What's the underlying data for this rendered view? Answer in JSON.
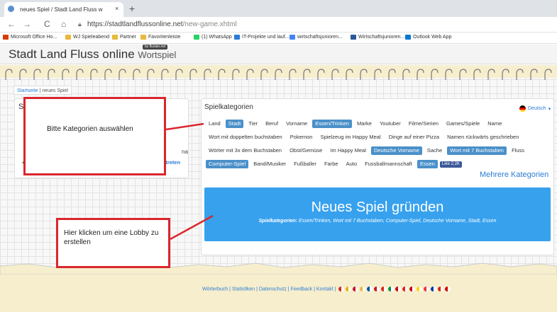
{
  "browser": {
    "tab_title": "neues Spiel / Stadt Land Fluss w",
    "tab_close": "×",
    "new_tab": "+",
    "url_host": "https://stadtlandflussonline.net",
    "url_path": "/new-game.xhtml",
    "nav": {
      "back": "←",
      "forward": "→",
      "reload": "C",
      "home": "⌂"
    },
    "bookmarks": [
      {
        "label": "Microsoft Office Ho...",
        "color": "#d83b01"
      },
      {
        "label": "WJ Spieleabend",
        "color": "#e8b93c"
      },
      {
        "label": "Partner",
        "color": "#e8b93c"
      },
      {
        "label": "Favoritenleiste",
        "color": "#e8b93c"
      },
      {
        "label": "(1) WhatsApp",
        "color": "#25d366"
      },
      {
        "label": "IT-Projekte und lauf...",
        "color": "#2b7bd6"
      },
      {
        "label": "wirtschaftsjunioren...",
        "color": "#4285f4"
      },
      {
        "label": "Wirtschaftsjunioren...",
        "color": "#2b579a"
      },
      {
        "label": "Outlook Web App",
        "color": "#0078d4"
      }
    ]
  },
  "site": {
    "title": "Stadt Land Fluss online",
    "subtitle": "Wortspiel",
    "badge": "by fluxian.net"
  },
  "breadcrumb": {
    "home": "Startseite",
    "current": "neues Spiel"
  },
  "left_panel": {
    "title_fragment": "S",
    "trailing_fragment": "na",
    "join_link": "dem Spiel beitreten"
  },
  "categories": {
    "title": "Spielkategorien",
    "language": "Deutsch",
    "items": [
      {
        "label": "Land",
        "selected": false
      },
      {
        "label": "Stadt",
        "selected": true
      },
      {
        "label": "Tier",
        "selected": false
      },
      {
        "label": "Beruf",
        "selected": false
      },
      {
        "label": "Vorname",
        "selected": false
      },
      {
        "label": "Essen/Trinken",
        "selected": true
      },
      {
        "label": "Marke",
        "selected": false
      },
      {
        "label": "Youtuber",
        "selected": false
      },
      {
        "label": "Filme/Serien",
        "selected": false
      },
      {
        "label": "Games/Spiele",
        "selected": false
      },
      {
        "label": "Name",
        "selected": false
      },
      {
        "label": "Wort mit doppelten buchstaben",
        "selected": false
      },
      {
        "label": "Pokemon",
        "selected": false
      },
      {
        "label": "Spielzeug im Happy Meal",
        "selected": false
      },
      {
        "label": "Dinge auf einer Pizza",
        "selected": false
      },
      {
        "label": "Namen rückwärts geschrieben",
        "selected": false
      },
      {
        "label": "Wörter mit 3x dem Buchstaben",
        "selected": false
      },
      {
        "label": "Obst/Gemüse",
        "selected": false
      },
      {
        "label": "Im Happy Meal",
        "selected": false
      },
      {
        "label": "Deutsche Vorname",
        "selected": true
      },
      {
        "label": "Sache",
        "selected": false
      },
      {
        "label": "Wort mit 7 Buchstaben",
        "selected": true
      },
      {
        "label": "Fluss",
        "selected": false
      },
      {
        "label": "Computer-Spiel",
        "selected": true
      },
      {
        "label": "Band/Musiker",
        "selected": false
      },
      {
        "label": "Fußballer",
        "selected": false
      },
      {
        "label": "Farbe",
        "selected": false
      },
      {
        "label": "Auto",
        "selected": false
      },
      {
        "label": "Fussballmannschaft",
        "selected": false
      },
      {
        "label": "Essen",
        "selected": true
      }
    ],
    "like_label": "Like 2,2K",
    "more_link": "Mehrere Kategorien"
  },
  "create_button": {
    "label": "Neues Spiel gründen",
    "sub_prefix": "Spielkategorien:",
    "sub_value": "Essen/Trinken, Wort mit 7 Buchstaben, Computer-Spiel, Deutsche Vorname, Stadt, Essen"
  },
  "annotations": {
    "callout_categories": "Bitte Kategorien auswählen",
    "callout_lobby": "Hier klicken um eine Lobby zu erstellen"
  },
  "footer": {
    "links": [
      "Wörterbuch",
      "Statistiken",
      "Datenschutz",
      "Feedback",
      "Kontakt"
    ],
    "flag_colors": [
      "#d52b1e",
      "#e4b400",
      "#c8102e",
      "#e8b93c",
      "#0055a4",
      "#ce1126",
      "#d52b1e",
      "#009246",
      "#c60b1e",
      "#d52b1e",
      "#cc0000",
      "#fcd116",
      "#ef3340",
      "#0039a6",
      "#d62612",
      "#cc0000"
    ]
  }
}
